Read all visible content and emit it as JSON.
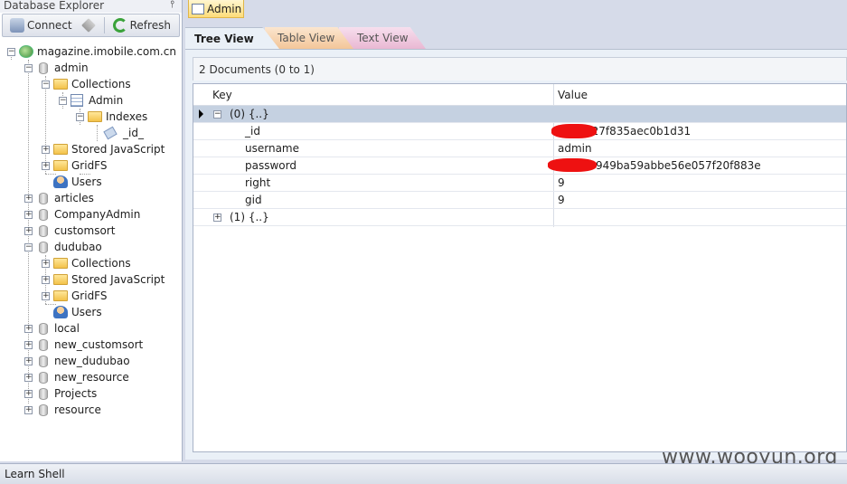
{
  "explorer": {
    "title": "Database Explorer",
    "pin_glyph": "⫯",
    "toolbar": {
      "connect_label": "Connect",
      "refresh_label": "Refresh"
    },
    "tree": {
      "server": "magazine.imobile.com.cn",
      "dbs": {
        "admin": {
          "name": "admin",
          "collections": "Collections",
          "collection_admin": "Admin",
          "indexes": "Indexes",
          "index_id": "_id_",
          "stored_js": "Stored JavaScript",
          "gridfs": "GridFS",
          "users": "Users"
        },
        "articles": "articles",
        "companyadmin": "CompanyAdmin",
        "customsort": "customsort",
        "dudubao": {
          "name": "dudubao",
          "collections": "Collections",
          "stored_js": "Stored JavaScript",
          "gridfs": "GridFS",
          "users": "Users"
        },
        "local": "local",
        "new_customsort": "new_customsort",
        "new_dudubao": "new_dudubao",
        "new_resource": "new_resource",
        "projects": "Projects",
        "resource": "resource"
      }
    }
  },
  "doc_tab": {
    "label": "Admin"
  },
  "views": {
    "tree": "Tree View",
    "table": "Table View",
    "text": "Text View"
  },
  "results": {
    "summary": "2 Documents (0 to 1)",
    "columns": {
      "key": "Key",
      "value": "Value"
    },
    "doc0": {
      "label": "(0) {..}",
      "fields": {
        "id": {
          "key": "_id",
          "value": "a34e327f835aec0b1d31"
        },
        "username": {
          "key": "username",
          "value": "admin"
        },
        "password": {
          "key": "password",
          "value": "949ba59abbe56e057f20f883e"
        },
        "right": {
          "key": "right",
          "value": "9"
        },
        "gid": {
          "key": "gid",
          "value": "9"
        }
      }
    },
    "doc1": {
      "label": "(1) {..}"
    }
  },
  "watermark": "www.wooyun.org",
  "status_bar": {
    "label": "Learn Shell"
  }
}
